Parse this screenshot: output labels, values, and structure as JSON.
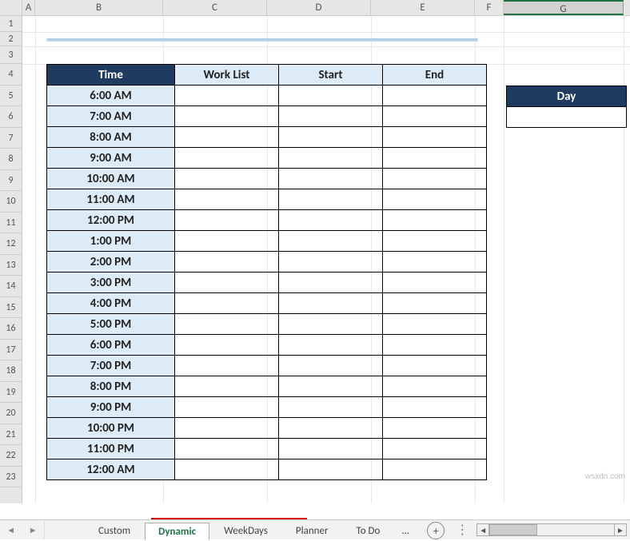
{
  "columns": [
    "A",
    "B",
    "C",
    "D",
    "E",
    "F",
    "G"
  ],
  "rows": [
    "1",
    "2",
    "3",
    "4",
    "5",
    "6",
    "7",
    "8",
    "9",
    "10",
    "11",
    "12",
    "13",
    "14",
    "15",
    "16",
    "17",
    "18",
    "19",
    "20",
    "21",
    "22",
    "23"
  ],
  "headers": {
    "time": "Time",
    "worklist": "Work List",
    "start": "Start",
    "end": "End",
    "day": "Day"
  },
  "times": [
    "6:00 AM",
    "7:00 AM",
    "8:00 AM",
    "9:00 AM",
    "10:00 AM",
    "11:00 AM",
    "12:00 PM",
    "1:00 PM",
    "2:00 PM",
    "3:00 PM",
    "4:00 PM",
    "5:00 PM",
    "6:00 PM",
    "7:00 PM",
    "8:00 PM",
    "9:00 PM",
    "10:00 PM",
    "11:00 PM",
    "12:00 AM"
  ],
  "tabs": {
    "items": [
      "Custom",
      "Dynamic",
      "WeekDays",
      "Planner",
      "To Do"
    ],
    "active_index": 1,
    "overflow": "..."
  },
  "watermark": "wsxdn.com",
  "chart_data": {
    "type": "table",
    "columns": [
      "Time",
      "Work List",
      "Start",
      "End"
    ],
    "rows": [
      [
        "6:00 AM",
        "",
        "",
        ""
      ],
      [
        "7:00 AM",
        "",
        "",
        ""
      ],
      [
        "8:00 AM",
        "",
        "",
        ""
      ],
      [
        "9:00 AM",
        "",
        "",
        ""
      ],
      [
        "10:00 AM",
        "",
        "",
        ""
      ],
      [
        "11:00 AM",
        "",
        "",
        ""
      ],
      [
        "12:00 PM",
        "",
        "",
        ""
      ],
      [
        "1:00 PM",
        "",
        "",
        ""
      ],
      [
        "2:00 PM",
        "",
        "",
        ""
      ],
      [
        "3:00 PM",
        "",
        "",
        ""
      ],
      [
        "4:00 PM",
        "",
        "",
        ""
      ],
      [
        "5:00 PM",
        "",
        "",
        ""
      ],
      [
        "6:00 PM",
        "",
        "",
        ""
      ],
      [
        "7:00 PM",
        "",
        "",
        ""
      ],
      [
        "8:00 PM",
        "",
        "",
        ""
      ],
      [
        "9:00 PM",
        "",
        "",
        ""
      ],
      [
        "10:00 PM",
        "",
        "",
        ""
      ],
      [
        "11:00 PM",
        "",
        "",
        ""
      ],
      [
        "12:00 AM",
        "",
        "",
        ""
      ]
    ],
    "side_table": {
      "header": "Day",
      "value": ""
    }
  }
}
